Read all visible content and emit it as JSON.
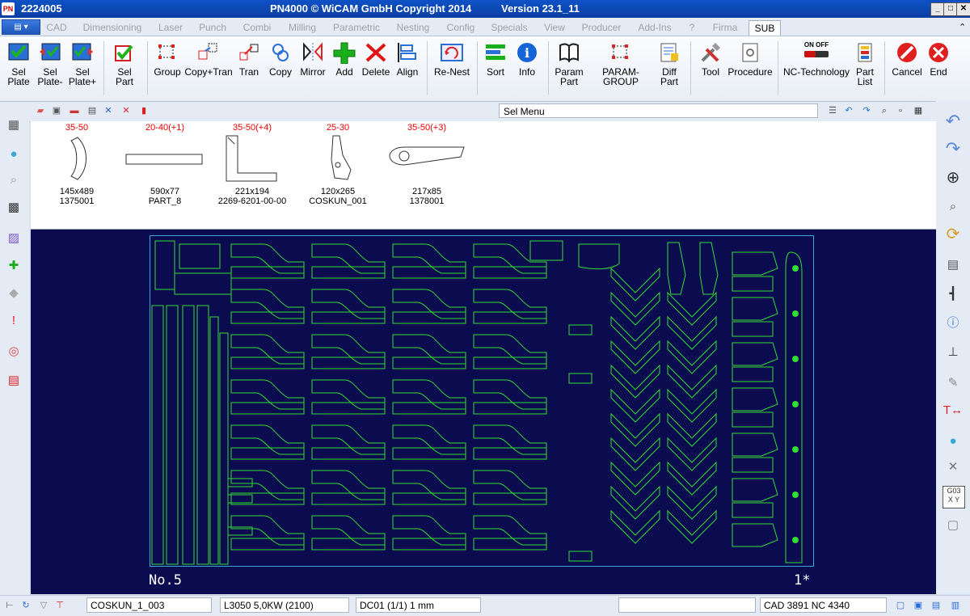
{
  "window": {
    "doc_id": "2224005",
    "title": "PN4000 © WiCAM GmbH Copyright 2014",
    "version": "Version 23.1_11"
  },
  "tabs": [
    "CAD",
    "Dimensioning",
    "Laser",
    "Punch",
    "Combi",
    "Milling",
    "Parametric",
    "Nesting",
    "Config",
    "Specials",
    "View",
    "Producer",
    "Add-Ins",
    "?",
    "Firma",
    "SUB"
  ],
  "active_tab": "SUB",
  "ribbon": {
    "sel_plate": [
      "Sel",
      "Plate"
    ],
    "sel_plate_minus": [
      "Sel",
      "Plate-"
    ],
    "sel_plate_plus": [
      "Sel",
      "Plate+"
    ],
    "sel_part": [
      "Sel",
      "Part"
    ],
    "group": "Group",
    "copy_tran": "Copy+Tran",
    "tran": "Tran",
    "copy": "Copy",
    "mirror": "Mirror",
    "add": "Add",
    "delete": "Delete",
    "align": "Align",
    "re_nest": "Re-Nest",
    "sort": "Sort",
    "info": "Info",
    "param_part": [
      "Param",
      "Part"
    ],
    "param_group": "PARAM-GROUP",
    "diff_part": [
      "Diff",
      "Part"
    ],
    "tool": "Tool",
    "procedure": "Procedure",
    "nc_technology": "NC-Technology",
    "nc_onoff": "ON OFF",
    "part_list": [
      "Part",
      "List"
    ],
    "cancel": "Cancel",
    "end": "End"
  },
  "sel_menu": "Sel Menu",
  "parts": [
    {
      "qty": "35-50",
      "size": "145x489",
      "name": "1375001"
    },
    {
      "qty": "20-40(+1)",
      "size": "590x77",
      "name": "PART_8"
    },
    {
      "qty": "35-50(+4)",
      "size": "221x194",
      "name": "2269-6201-00-00"
    },
    {
      "qty": "25-30",
      "size": "120x265",
      "name": "COSKUN_001"
    },
    {
      "qty": "35-50(+3)",
      "size": "217x85",
      "name": "1378001"
    }
  ],
  "canvas": {
    "plate_label": "No.5",
    "plate_star": "1*"
  },
  "status": {
    "job": "COSKUN_1_003",
    "machine": "L3050  5,0KW   (2100)",
    "dc": "DC01   (1/1)     1 mm",
    "counts": "CAD 3891    NC 4340"
  },
  "colors": {
    "canvas_bg": "#0b0b50",
    "part_outline": "#33dd33",
    "plate_border": "#3aa7d8",
    "qty_text": "#e00000"
  }
}
